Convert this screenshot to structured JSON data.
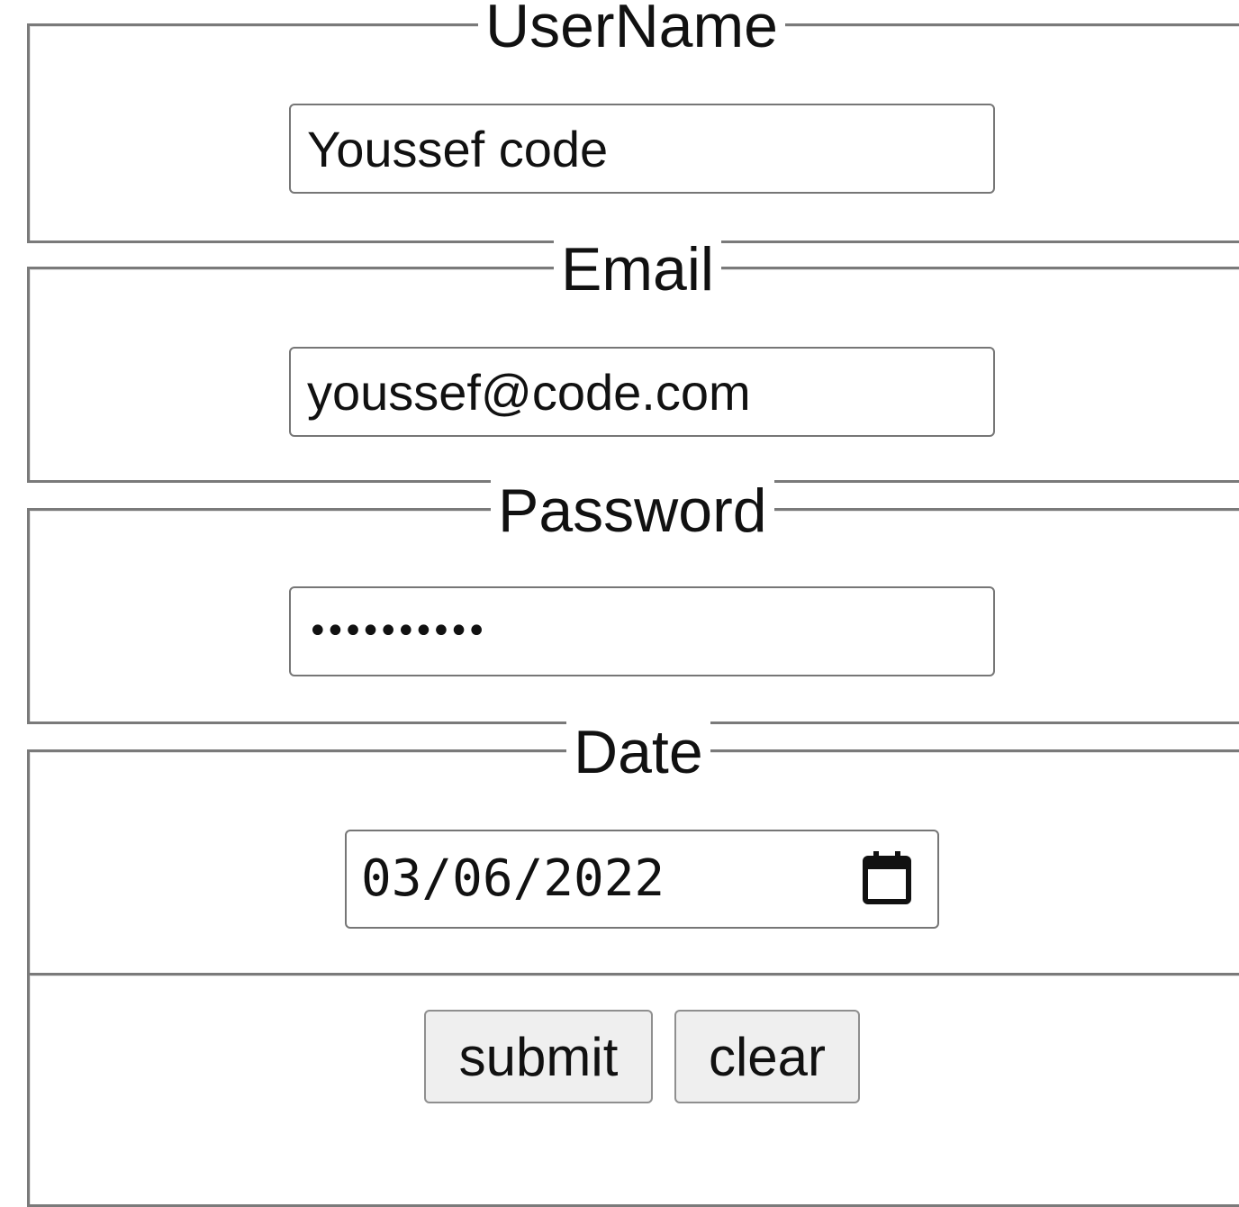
{
  "form": {
    "username": {
      "legend": "UserName",
      "value": "Youssef code"
    },
    "email": {
      "legend": "Email",
      "value": "youssef@code.com"
    },
    "password": {
      "legend": "Password",
      "masked_value": "••••••••••"
    },
    "date": {
      "legend": "Date",
      "value": "03/06/2022",
      "icon": "calendar-icon"
    },
    "actions": {
      "submit_label": "submit",
      "clear_label": "clear"
    }
  }
}
